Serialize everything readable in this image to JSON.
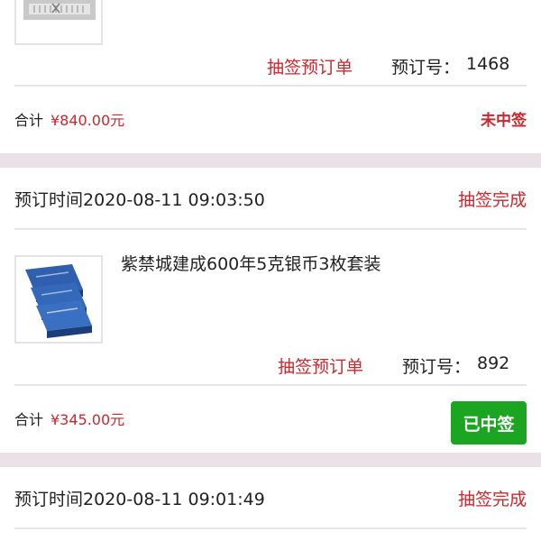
{
  "orders": [
    {
      "presale_label": "抽签预订单",
      "order_no_label": "预订号：",
      "order_no": "1468",
      "total_label": "合计",
      "total_value": "¥840.00元",
      "result": "未中签"
    },
    {
      "time_label": "预订时间",
      "time": "2020-08-11 09:03:50",
      "status": "抽签完成",
      "product_name": "紫禁城建成600年5克银币3枚套装",
      "presale_label": "抽签预订单",
      "order_no_label": "预订号：",
      "order_no": "892",
      "total_label": "合计",
      "total_value": "¥345.00元",
      "result": "已中签"
    },
    {
      "time_label": "预订时间",
      "time": "2020-08-11 09:01:49",
      "status": "抽签完成"
    }
  ],
  "colors": {
    "accent_red": "#c9282e",
    "won_green": "#1ba520",
    "separator": "#e9e1e5"
  }
}
